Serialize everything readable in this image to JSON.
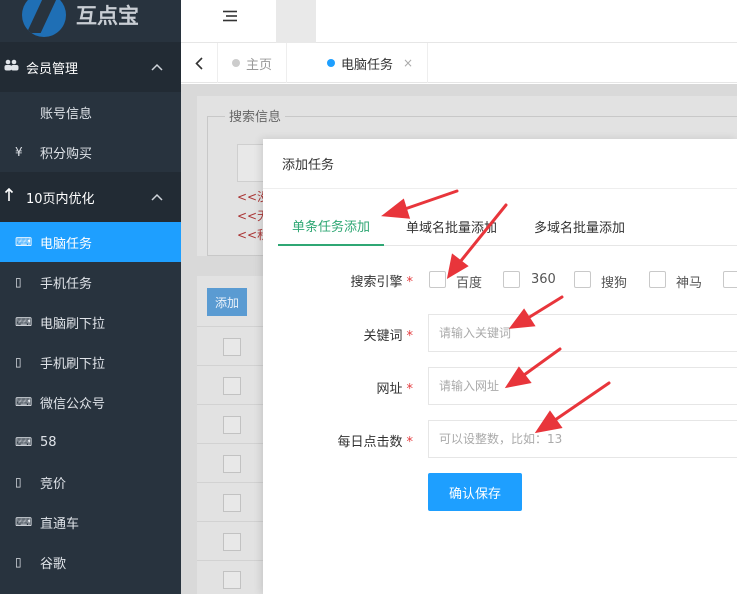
{
  "sidebar": {
    "logo_text": "互点宝",
    "groups": [
      {
        "icon": "users-icon",
        "label": "会员管理",
        "chevron": "^"
      },
      {
        "icon": "up-arrow-icon",
        "label": "10页内优化",
        "chevron": "^"
      }
    ],
    "member_items": [
      {
        "icon": "",
        "label": "账号信息"
      },
      {
        "icon": "¥",
        "label": "积分购买"
      }
    ],
    "opt_items": [
      {
        "icon": "⌨",
        "label": "电脑任务",
        "active": true
      },
      {
        "icon": "▯",
        "label": "手机任务"
      },
      {
        "icon": "⌨",
        "label": "电脑刷下拉"
      },
      {
        "icon": "▯",
        "label": "手机刷下拉"
      },
      {
        "icon": "⌨",
        "label": "微信公众号"
      },
      {
        "icon": "⌨",
        "label": "58"
      },
      {
        "icon": "▯",
        "label": "竞价"
      },
      {
        "icon": "⌨",
        "label": "直通车"
      },
      {
        "icon": "▯",
        "label": "谷歌"
      }
    ]
  },
  "topbar": {
    "menu_icon": "menu-icon"
  },
  "tabstrip": {
    "back": "<",
    "tabs": [
      {
        "label": "主页",
        "active": false
      },
      {
        "label": "电脑任务",
        "active": true,
        "close": "×"
      }
    ]
  },
  "background": {
    "search_title": "搜索信息",
    "red_lines": [
      "<<没",
      "<<无",
      "<<积"
    ],
    "add_label": "添加"
  },
  "modal": {
    "title": "添加任务",
    "tabs": [
      "单条任务添加",
      "单域名批量添加",
      "多域名批量添加"
    ],
    "engine_label": "搜索引擎",
    "engines": [
      "百度",
      "360",
      "搜狗",
      "神马"
    ],
    "keyword_label": "关键词",
    "keyword_placeholder": "请输入关键词",
    "url_label": "网址",
    "url_placeholder": "请输入网址",
    "clicks_label": "每日点击数",
    "clicks_placeholder": "可以设整数，比如：13",
    "save_label": "确认保存"
  },
  "colors": {
    "sidebar_bg": "#28333e",
    "active_blue": "#1e9fff",
    "tab_green": "#2fa774",
    "arrow_red": "#e8353b"
  }
}
